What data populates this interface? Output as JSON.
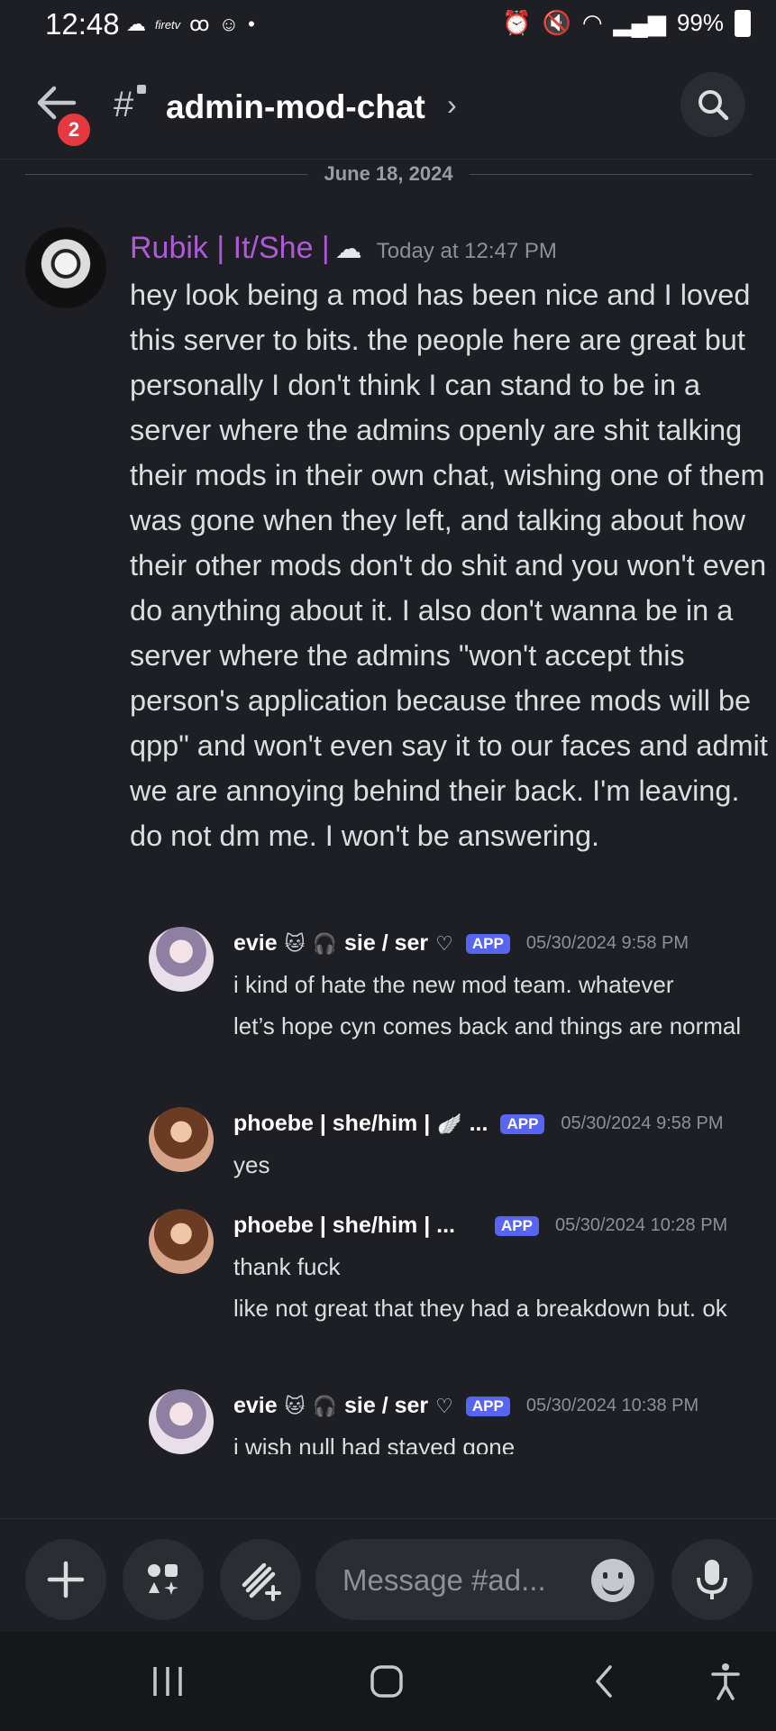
{
  "status_bar": {
    "time": "12:48",
    "left_icon_label": "firetv",
    "battery": "99%"
  },
  "header": {
    "badge_count": "2",
    "channel_name": "admin-mod-chat",
    "chevron": "›"
  },
  "date_divider": "June 18, 2024",
  "main_message": {
    "author": "Rubik | It/She |",
    "timestamp": "Today at 12:47 PM",
    "text": "hey look being a mod has been nice and I loved this server to bits. the people here are great but personally I don't think I can stand to be in a server where the admins openly are shit talking their mods in their own chat, wishing one of them was gone when they left, and talking about how their other mods don't do shit and you won't even do anything about it. I also don't wanna be in a server where the admins \"won't accept this person's application because three mods will be qpp\" and won't even say it to our faces and admit we are annoying behind their back. I'm leaving. do not dm me. I won't be answering."
  },
  "quoted_messages": [
    {
      "name": "evie",
      "name_suffix": "sie / ser",
      "tag": "APP",
      "timestamp": "05/30/2024 9:58 PM",
      "lines": [
        "i kind of hate the new mod team. whatever",
        "let’s hope cyn comes back and things are normal"
      ]
    },
    {
      "name": "phoebe | she/him |",
      "name_suffix": "...",
      "tag": "APP",
      "timestamp": "05/30/2024 9:58 PM",
      "lines": [
        "yes"
      ]
    },
    {
      "name": "phoebe | she/him | ...",
      "name_suffix": "",
      "tag": "APP",
      "timestamp": "05/30/2024 10:28 PM",
      "lines": [
        "thank fuck",
        "like not great that they had a breakdown but. ok"
      ]
    },
    {
      "name": "evie",
      "name_suffix": "sie / ser",
      "tag": "APP",
      "timestamp": "05/30/2024 10:38 PM",
      "lines": [
        "i wish null had stayed gone"
      ]
    }
  ],
  "input": {
    "placeholder": "Message #ad..."
  },
  "colors": {
    "background": "#1e1f24",
    "author_main": "#b15ad7",
    "app_tag": "#5865f2",
    "badge": "#e5393f"
  },
  "icons": [
    "back-arrow-icon",
    "hash-lock-icon",
    "search-icon",
    "plus-icon",
    "apps-icon",
    "gift-icon",
    "emoji-icon",
    "microphone-icon",
    "recents-icon",
    "home-icon",
    "back-icon",
    "accessibility-icon"
  ]
}
